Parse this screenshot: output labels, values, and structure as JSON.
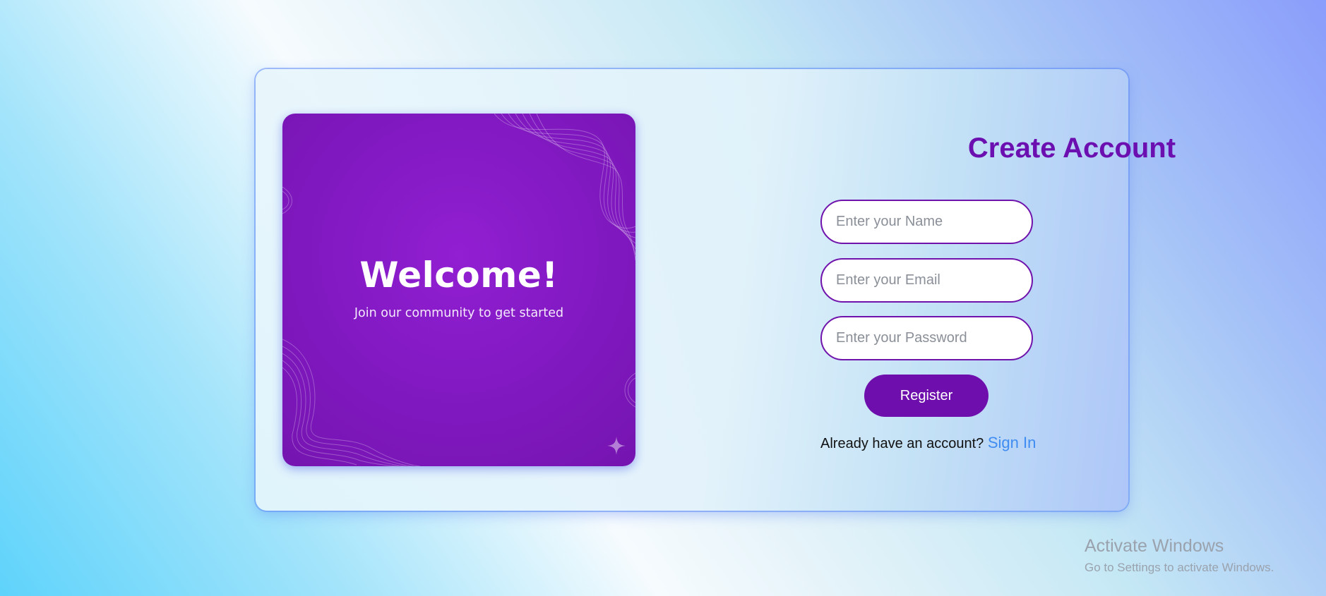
{
  "hero": {
    "heading": "Welcome!",
    "tagline": "Join our community to get started",
    "decoration_icon": "sparkle-icon"
  },
  "form": {
    "title": "Create Account",
    "name_placeholder": "Enter your Name",
    "email_placeholder": "Enter your Email",
    "password_placeholder": "Enter your Password",
    "register_label": "Register",
    "signin_prompt": "Already have an account?",
    "signin_link": "Sign In"
  },
  "watermark": {
    "title": "Activate Windows",
    "subtitle": "Go to Settings to activate Windows."
  },
  "colors": {
    "accent": "#6e0eac",
    "link": "#3f8cf2",
    "hero_bg": "#8a1ac8"
  }
}
